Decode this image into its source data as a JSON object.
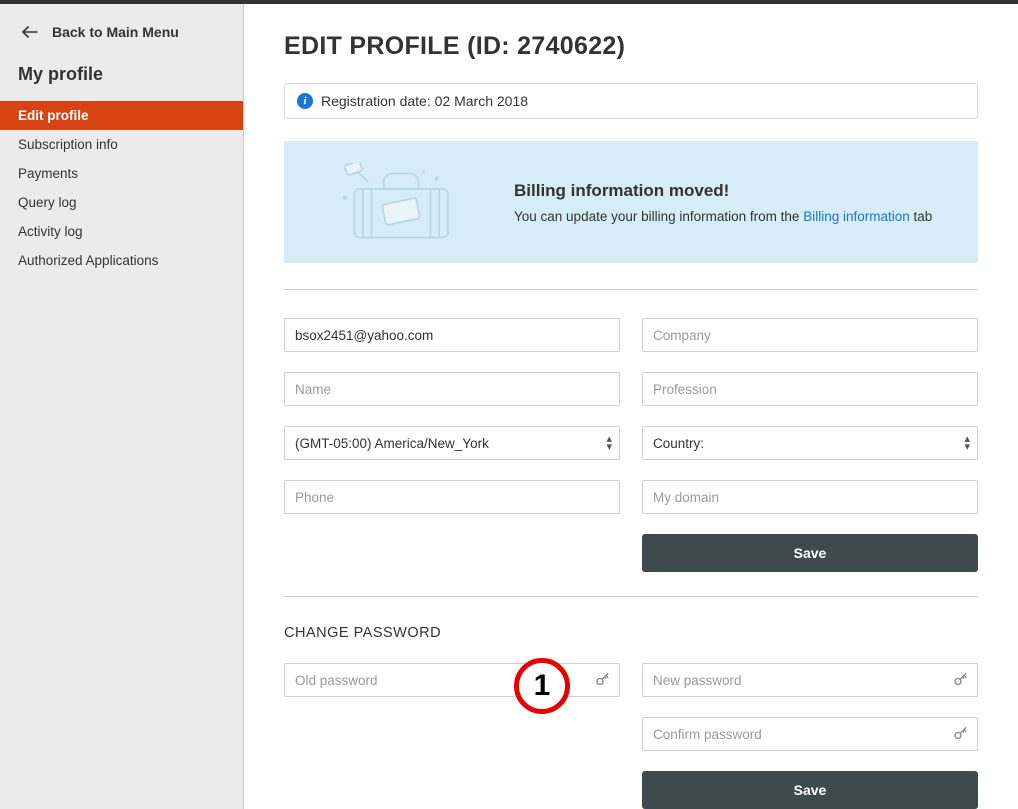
{
  "back_label": "Back to Main Menu",
  "sidebar": {
    "heading": "My profile",
    "items": [
      {
        "label": "Edit profile",
        "active": true
      },
      {
        "label": "Subscription info",
        "active": false
      },
      {
        "label": "Payments",
        "active": false
      },
      {
        "label": "Query log",
        "active": false
      },
      {
        "label": "Activity log",
        "active": false
      },
      {
        "label": "Authorized Applications",
        "active": false
      }
    ]
  },
  "page_title": "EDIT PROFILE (ID: 2740622)",
  "registration_line": "Registration date: 02 March 2018",
  "billing_moved": {
    "title": "Billing information moved!",
    "text_before": "You can update your billing information from the ",
    "link": "Billing information",
    "text_after": " tab"
  },
  "form": {
    "email_value": "bsox2451@yahoo.com",
    "company_placeholder": "Company",
    "name_placeholder": "Name",
    "profession_placeholder": "Profession",
    "timezone_value": "(GMT-05:00) America/New_York",
    "country_value": "Country:",
    "phone_placeholder": "Phone",
    "domain_placeholder": "My domain",
    "save_label": "Save"
  },
  "password_section": {
    "heading": "CHANGE PASSWORD",
    "old_placeholder": "Old password",
    "new_placeholder": "New password",
    "confirm_placeholder": "Confirm password",
    "save_label": "Save"
  },
  "annotation_number": "1"
}
